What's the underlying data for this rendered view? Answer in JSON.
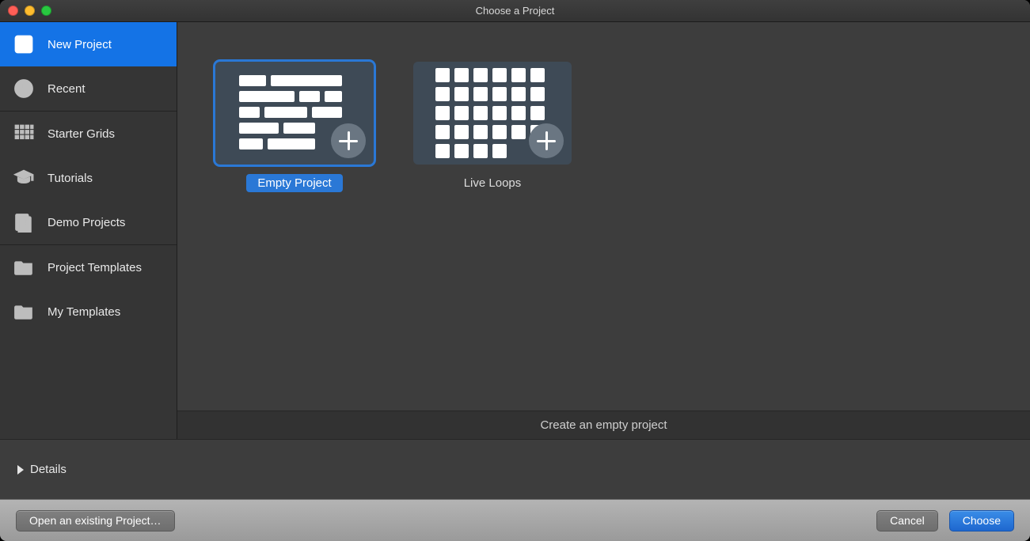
{
  "window": {
    "title": "Choose a Project"
  },
  "sidebar": {
    "items": [
      {
        "label": "New Project"
      },
      {
        "label": "Recent"
      },
      {
        "label": "Starter Grids"
      },
      {
        "label": "Tutorials"
      },
      {
        "label": "Demo Projects"
      },
      {
        "label": "Project Templates"
      },
      {
        "label": "My Templates"
      }
    ],
    "selected_index": 0
  },
  "gallery": {
    "tiles": [
      {
        "label": "Empty Project",
        "selected": true
      },
      {
        "label": "Live Loops",
        "selected": false
      }
    ],
    "description": "Create an empty project"
  },
  "details": {
    "label": "Details",
    "expanded": false
  },
  "actions": {
    "open_existing": "Open an existing Project…",
    "cancel": "Cancel",
    "choose": "Choose"
  }
}
